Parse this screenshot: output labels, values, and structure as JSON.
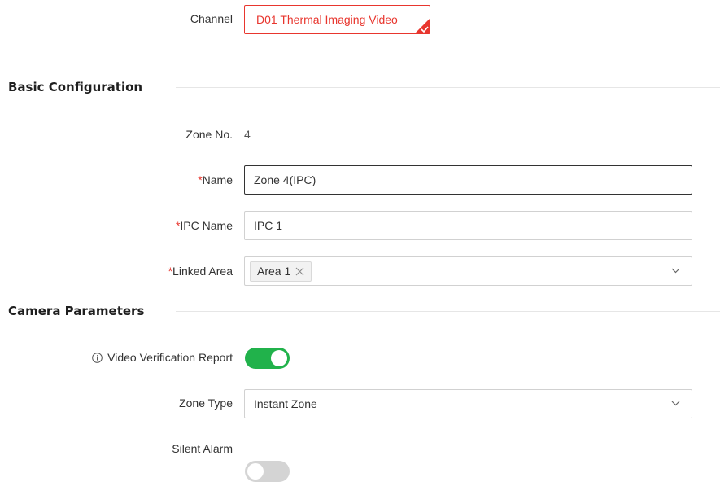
{
  "channel": {
    "label": "Channel",
    "value": "D01 Thermal Imaging Video"
  },
  "basic": {
    "title": "Basic Configuration",
    "zone_no_label": "Zone No.",
    "zone_no_value": "4",
    "name_label": "Name",
    "name_value": "Zone 4(IPC)",
    "ipc_name_label": "IPC Name",
    "ipc_name_value": "IPC 1",
    "linked_area_label": "Linked Area",
    "linked_area_tag": "Area 1",
    "required_mark": "*"
  },
  "camera": {
    "title": "Camera Parameters",
    "video_verification_label": "Video Verification Report",
    "video_verification_on": true,
    "zone_type_label": "Zone Type",
    "zone_type_value": "Instant Zone",
    "silent_alarm_label": "Silent Alarm",
    "silent_alarm_on": false
  },
  "colors": {
    "accent_red": "#e8362e",
    "toggle_on": "#21b24b",
    "toggle_off": "#d4d4d4"
  },
  "icons": [
    "check-icon",
    "close-icon",
    "chevron-down-icon",
    "info-icon"
  ]
}
